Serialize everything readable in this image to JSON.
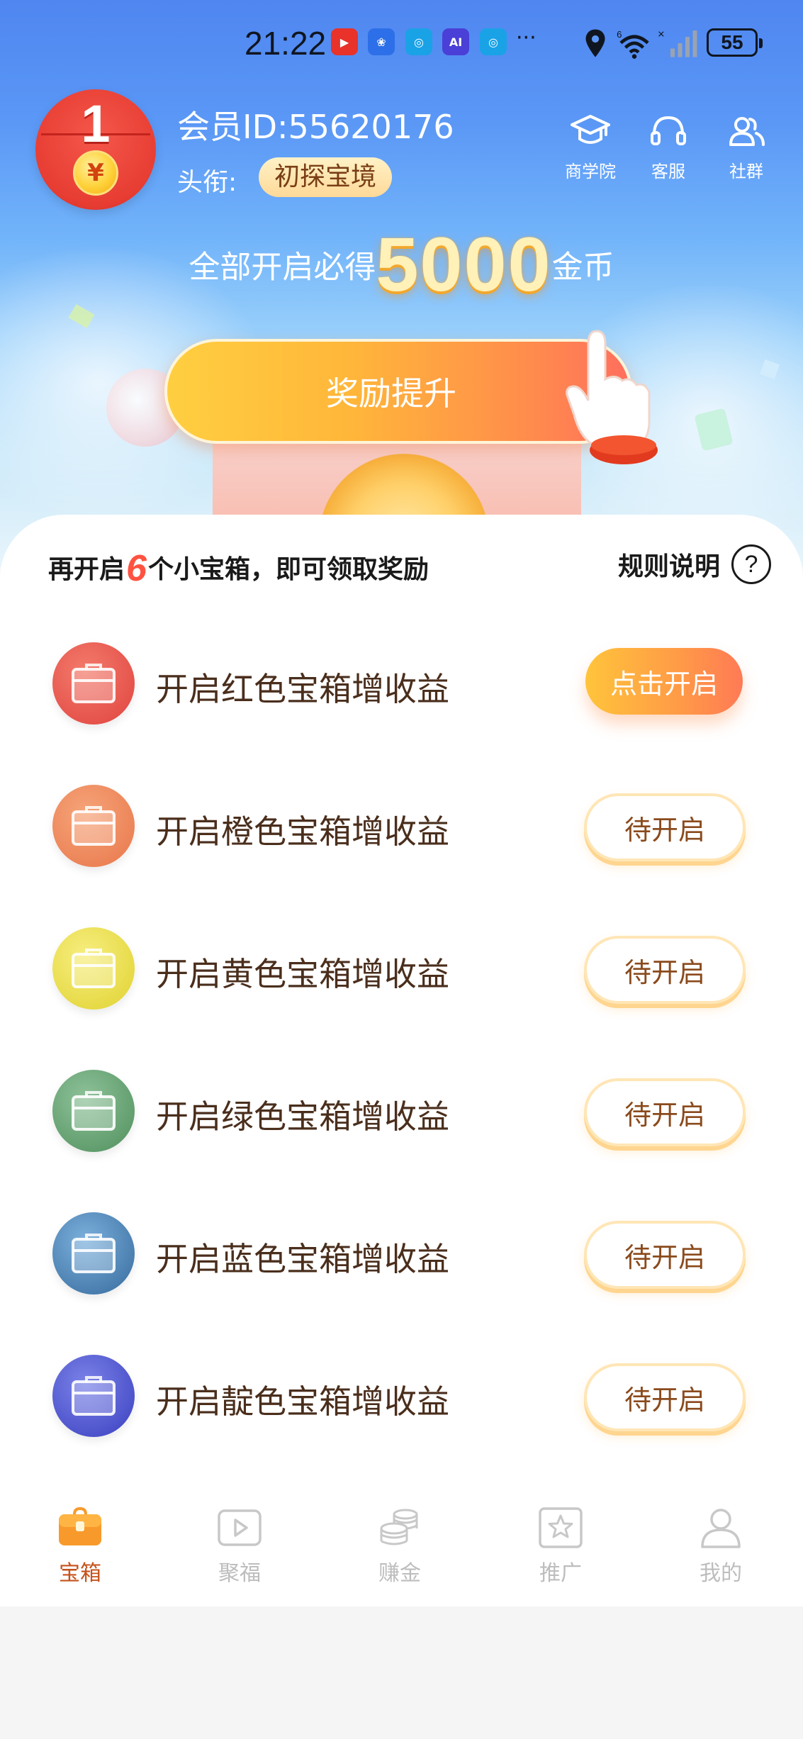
{
  "status_bar": {
    "time": "21:22",
    "battery": "55",
    "apps": [
      {
        "icon": "video-app-icon",
        "color": "#e8322a",
        "text": "▶"
      },
      {
        "icon": "baidu-app-icon",
        "color": "#2d6fe8",
        "text": "❀"
      },
      {
        "icon": "browser-app-icon",
        "color": "#1aa2e6",
        "text": "◎"
      },
      {
        "icon": "ai-app-icon",
        "color": "#4a3fd6",
        "text": "AI"
      },
      {
        "icon": "browser-app-icon-2",
        "color": "#1aa2e6",
        "text": "◎"
      }
    ],
    "more": "···"
  },
  "profile": {
    "avatar_number": "1",
    "avatar_coin": "¥",
    "member_id": "会员ID:55620176",
    "rank_label": "头衔:",
    "rank_value": "初探宝境"
  },
  "top_links": [
    {
      "label": "商学院",
      "icon": "graduation-cap-icon"
    },
    {
      "label": "客服",
      "icon": "headset-icon"
    },
    {
      "label": "社群",
      "icon": "group-icon"
    }
  ],
  "headline": {
    "prefix": "全部开启必得",
    "amount": "5000",
    "suffix": "金币"
  },
  "boost_button": "奖励提升",
  "card": {
    "title_prefix": "再开启",
    "title_count": "6",
    "title_suffix": "个小宝箱，即可领取奖励",
    "rules": "规则说明",
    "rules_icon": "?"
  },
  "chests": [
    {
      "label": "开启红色宝箱增收益",
      "button": "点击开启",
      "state": "active",
      "color_from": "#f37b6c",
      "color_to": "#e0433e"
    },
    {
      "label": "开启橙色宝箱增收益",
      "button": "待开启",
      "state": "pending",
      "color_from": "#f6a479",
      "color_to": "#e8774b"
    },
    {
      "label": "开启黄色宝箱增收益",
      "button": "待开启",
      "state": "pending",
      "color_from": "#f7ee80",
      "color_to": "#e0d230"
    },
    {
      "label": "开启绿色宝箱增收益",
      "button": "待开启",
      "state": "pending",
      "color_from": "#8fc29a",
      "color_to": "#4f8f5c"
    },
    {
      "label": "开启蓝色宝箱增收益",
      "button": "待开启",
      "state": "pending",
      "color_from": "#7cb0dc",
      "color_to": "#356a9c"
    },
    {
      "label": "开启靛色宝箱增收益",
      "button": "待开启",
      "state": "pending",
      "color_from": "#7b83e8",
      "color_to": "#3a3fbf"
    }
  ],
  "bottom_nav": [
    {
      "label": "宝箱",
      "icon": "chest-icon",
      "active": true
    },
    {
      "label": "聚福",
      "icon": "play-icon",
      "active": false
    },
    {
      "label": "赚金",
      "icon": "coins-icon",
      "active": false
    },
    {
      "label": "推广",
      "icon": "star-icon",
      "active": false
    },
    {
      "label": "我的",
      "icon": "user-icon",
      "active": false
    }
  ],
  "colors": {
    "accent": "#ff5240",
    "active_nav": "#c6521b",
    "label_brown": "#4a2e1c"
  }
}
